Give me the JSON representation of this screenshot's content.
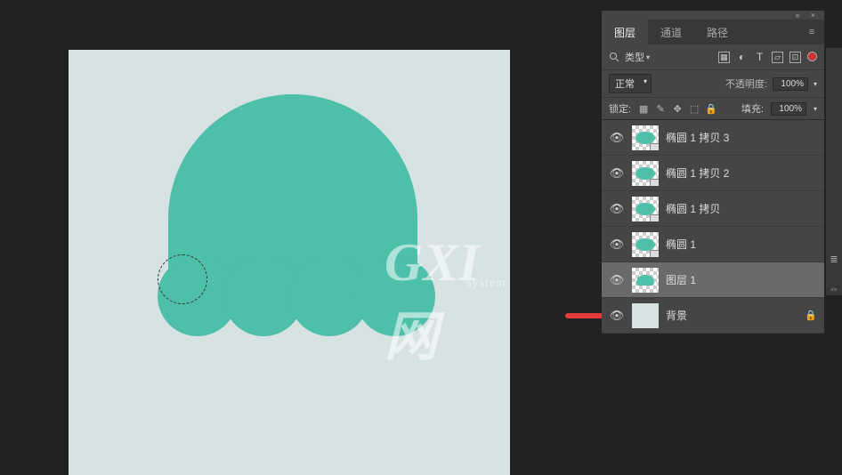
{
  "panels": {
    "tabs": [
      "图层",
      "通道",
      "路径"
    ],
    "active_tab": 0,
    "filter": {
      "type_label": "类型"
    },
    "blend": {
      "mode": "正常",
      "opacity_label": "不透明度:",
      "opacity_value": "100%"
    },
    "lock": {
      "label": "锁定:",
      "fill_label": "填充:",
      "fill_value": "100%"
    }
  },
  "layers": [
    {
      "name": "椭圆 1 拷贝 3",
      "type": "shape",
      "selected": false
    },
    {
      "name": "椭圆 1 拷贝 2",
      "type": "shape",
      "selected": false
    },
    {
      "name": "椭圆 1 拷贝",
      "type": "shape",
      "selected": false
    },
    {
      "name": "椭圆 1",
      "type": "shape",
      "selected": false
    },
    {
      "name": "图层 1",
      "type": "raster",
      "selected": true
    },
    {
      "name": "背景",
      "type": "bg",
      "selected": false,
      "locked": true
    }
  ],
  "watermark": {
    "big": "GXI网",
    "small": "system.com"
  },
  "topbar": {
    "collapse": "«",
    "close": "×"
  },
  "chart_data": null
}
